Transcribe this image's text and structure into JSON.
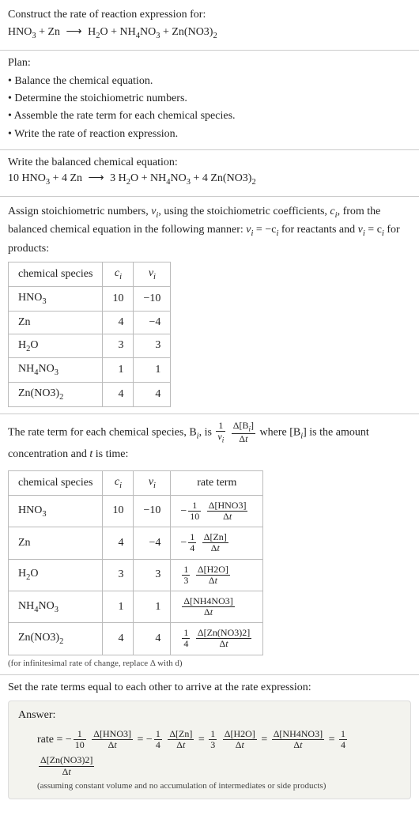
{
  "intro": {
    "prompt": "Construct the rate of reaction expression for:",
    "equation_lhs_1": "HNO",
    "equation_lhs_1_sub": "3",
    "equation_lhs_plus": " + Zn ",
    "arrow": "⟶",
    "equation_rhs_1": " H",
    "equation_rhs_1_sub": "2",
    "equation_rhs_1b": "O + NH",
    "equation_rhs_2_sub": "4",
    "equation_rhs_2b": "NO",
    "equation_rhs_3_sub": "3",
    "equation_rhs_3b": " + Zn(NO3)",
    "equation_rhs_4_sub": "2"
  },
  "plan": {
    "title": "Plan:",
    "items": [
      "Balance the chemical equation.",
      "Determine the stoichiometric numbers.",
      "Assemble the rate term for each chemical species.",
      "Write the rate of reaction expression."
    ]
  },
  "balanced": {
    "title": "Write the balanced chemical equation:",
    "c1": "10 HNO",
    "c1s": "3",
    "c2": " + 4 Zn ",
    "arrow": "⟶",
    "c3": " 3 H",
    "c3s": "2",
    "c4": "O + NH",
    "c4s": "4",
    "c5": "NO",
    "c5s": "3",
    "c6": " + 4 Zn(NO3)",
    "c6s": "2"
  },
  "stoich": {
    "intro1": "Assign stoichiometric numbers, ",
    "nu_i": "ν",
    "nu_i_sub": "i",
    "intro2": ", using the stoichiometric coefficients, ",
    "c_i": "c",
    "c_i_sub": "i",
    "intro3": ", from the balanced chemical equation in the following manner: ",
    "rel1a": "ν",
    "rel1b": "i",
    "rel1c": " = −c",
    "rel1d": "i",
    "rel1e": " for reactants and ",
    "rel2a": "ν",
    "rel2b": "i",
    "rel2c": " = c",
    "rel2d": "i",
    "rel2e": " for products:",
    "headers": [
      "chemical species",
      "c",
      "ν"
    ],
    "header_sub": "i",
    "rows": [
      {
        "sp_a": "HNO",
        "sp_s": "3",
        "sp_b": "",
        "c": "10",
        "nu": "−10"
      },
      {
        "sp_a": "Zn",
        "sp_s": "",
        "sp_b": "",
        "c": "4",
        "nu": "−4"
      },
      {
        "sp_a": "H",
        "sp_s": "2",
        "sp_b": "O",
        "c": "3",
        "nu": "3"
      },
      {
        "sp_a": "NH",
        "sp_s": "4",
        "sp_b": "NO",
        "sp_s2": "3",
        "c": "1",
        "nu": "1"
      },
      {
        "sp_a": "Zn(NO3)",
        "sp_s": "2",
        "sp_b": "",
        "c": "4",
        "nu": "4"
      }
    ]
  },
  "rateterm": {
    "intro1": "The rate term for each chemical species, B",
    "intro1_sub": "i",
    "intro2": ", is ",
    "frac1_num": "1",
    "frac1_den_a": "ν",
    "frac1_den_sub": "i",
    "frac2_num_a": "Δ[B",
    "frac2_num_sub": "i",
    "frac2_num_b": "]",
    "frac2_den": "Δt",
    "intro3": " where [B",
    "intro3_sub": "i",
    "intro4": "] is the amount concentration and ",
    "t_var": "t",
    "intro5": " is time:",
    "headers": [
      "chemical species",
      "c",
      "ν",
      "rate term"
    ],
    "header_sub": "i",
    "rows": [
      {
        "sp_a": "HNO",
        "sp_s": "3",
        "sp_b": "",
        "c": "10",
        "nu": "−10",
        "sign": "−",
        "coef_num": "1",
        "coef_den": "10",
        "conc": "Δ[HNO3]",
        "dt": "Δt"
      },
      {
        "sp_a": "Zn",
        "sp_s": "",
        "sp_b": "",
        "c": "4",
        "nu": "−4",
        "sign": "−",
        "coef_num": "1",
        "coef_den": "4",
        "conc": "Δ[Zn]",
        "dt": "Δt"
      },
      {
        "sp_a": "H",
        "sp_s": "2",
        "sp_b": "O",
        "c": "3",
        "nu": "3",
        "sign": "",
        "coef_num": "1",
        "coef_den": "3",
        "conc": "Δ[H2O]",
        "dt": "Δt"
      },
      {
        "sp_a": "NH",
        "sp_s": "4",
        "sp_b": "NO",
        "sp_s2": "3",
        "c": "1",
        "nu": "1",
        "sign": "",
        "coef_num": "",
        "coef_den": "",
        "conc": "Δ[NH4NO3]",
        "dt": "Δt"
      },
      {
        "sp_a": "Zn(NO3)",
        "sp_s": "2",
        "sp_b": "",
        "c": "4",
        "nu": "4",
        "sign": "",
        "coef_num": "1",
        "coef_den": "4",
        "conc": "Δ[Zn(NO3)2]",
        "dt": "Δt"
      }
    ],
    "note": "(for infinitesimal rate of change, replace Δ with d)"
  },
  "final": {
    "prompt": "Set the rate terms equal to each other to arrive at the rate expression:",
    "answer_title": "Answer:",
    "rate_label": "rate = ",
    "terms": [
      {
        "sign": "−",
        "coef_num": "1",
        "coef_den": "10",
        "conc": "Δ[HNO3]",
        "dt": "Δt"
      },
      {
        "sign": "−",
        "coef_num": "1",
        "coef_den": "4",
        "conc": "Δ[Zn]",
        "dt": "Δt"
      },
      {
        "sign": "",
        "coef_num": "1",
        "coef_den": "3",
        "conc": "Δ[H2O]",
        "dt": "Δt"
      },
      {
        "sign": "",
        "coef_num": "",
        "coef_den": "",
        "conc": "Δ[NH4NO3]",
        "dt": "Δt"
      },
      {
        "sign": "",
        "coef_num": "1",
        "coef_den": "4",
        "conc": "Δ[Zn(NO3)2]",
        "dt": "Δt"
      }
    ],
    "eq_sep": " = ",
    "note": "(assuming constant volume and no accumulation of intermediates or side products)"
  }
}
